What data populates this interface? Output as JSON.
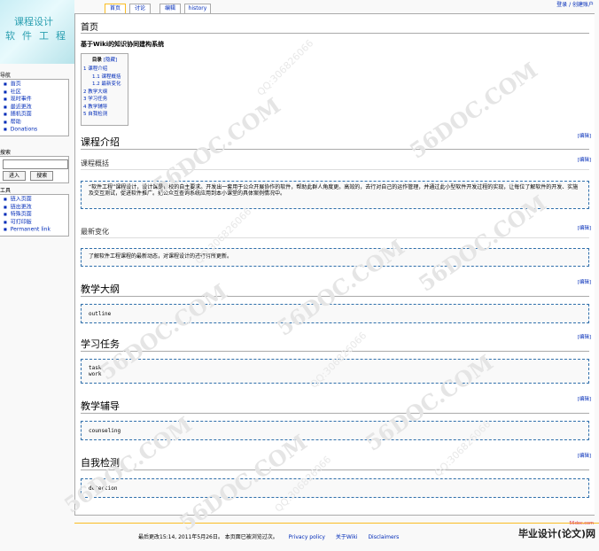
{
  "logo": {
    "line1": "课程设计",
    "line2": "软件工程"
  },
  "tabs": [
    {
      "label": "首页",
      "selected": true
    },
    {
      "label": "讨论",
      "selected": false
    },
    {
      "label": "编辑",
      "selected": false
    },
    {
      "label": "history",
      "selected": false
    }
  ],
  "userlinks": "登录 / 创建账户",
  "nav": {
    "title": "导航",
    "items": [
      "首页",
      "社区",
      "现时事件",
      "最近更改",
      "随机页面",
      "帮助",
      "Donations"
    ]
  },
  "search": {
    "title": "搜索",
    "go": "进入",
    "search": "搜索"
  },
  "tools": {
    "title": "工具",
    "items": [
      "链入页面",
      "链出更改",
      "特殊页面",
      "可打印版",
      "Permanent link"
    ]
  },
  "page": {
    "title": "首页",
    "subtitle": "基于Wiki的知识协同建构系统",
    "toc": {
      "title": "目录",
      "hide": "[隐藏]",
      "items": [
        "1 课程介绍",
        "1.1 课程概括",
        "1.2 最新变化",
        "2 教学大纲",
        "3 学习任务",
        "4 教学辅导",
        "5 自我检测"
      ]
    },
    "edit": "[编辑]",
    "sections": {
      "intro": "课程介绍",
      "overview": "课程概括",
      "overview_text": "“软件工程”课程设计，设计课是各校的自主要求。开发出一套用于公众开展协作的软件，帮助此群人角度更。高效的，去行对自己的运作管理，并通过此小型软件开发过程的实现，让每位了解软件的开发、实施及交互测试，促进软件推广。把公众互查询系统应用到本小课堂的具体案例情况中。",
      "recent": "最新变化",
      "recent_text": "了解软件工程课程的最新动态，对课程设计的进行有所更新。",
      "outline": "教学大纲",
      "outline_pre": "outline",
      "tasks": "学习任务",
      "tasks_pre": [
        "task",
        "work"
      ],
      "tutoring": "教学辅导",
      "tutoring_pre": "counseling",
      "selftest": "自我检测",
      "selftest_pre": "detection"
    }
  },
  "footer": {
    "text": "最后更改15:14, 2011年5月26日。 本页面已被浏览过次。",
    "links": [
      "Privacy policy",
      "关于Wiki",
      "Disclaimers"
    ]
  },
  "watermarks": [
    "56DOC.COM",
    "QQ:306826066"
  ],
  "bottom_logo": {
    "site": "56doc.com",
    "name": "毕业设计(论文)网"
  }
}
